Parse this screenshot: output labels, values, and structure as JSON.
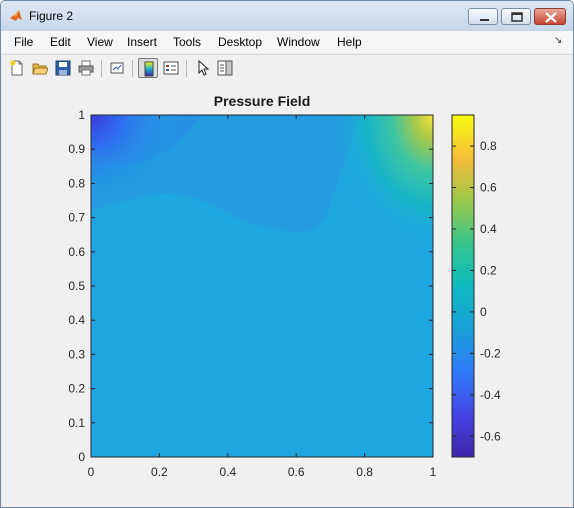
{
  "window": {
    "title": "Figure 2",
    "minimize_label": "minimize",
    "maximize_label": "maximize",
    "close_label": "close"
  },
  "menu": [
    "File",
    "Edit",
    "View",
    "Insert",
    "Tools",
    "Desktop",
    "Window",
    "Help"
  ],
  "toolbar": {
    "buttons": [
      "new-figure",
      "open-file",
      "save-figure",
      "print-figure",
      "link-plot",
      "insert-colorbar",
      "insert-legend",
      "edit-plot",
      "show-plot-tools"
    ],
    "pressed": "insert-colorbar"
  },
  "chart_data": {
    "type": "heatmap",
    "title": "Pressure Field",
    "xlabel": "",
    "ylabel": "",
    "xlim": [
      0,
      1
    ],
    "ylim": [
      0,
      1
    ],
    "xticks": [
      "0",
      "0.2",
      "0.4",
      "0.6",
      "0.8",
      "1"
    ],
    "yticks": [
      "0",
      "0.1",
      "0.2",
      "0.3",
      "0.4",
      "0.5",
      "0.6",
      "0.7",
      "0.8",
      "0.9",
      "1"
    ],
    "colorbar": {
      "range": [
        -0.7,
        0.95
      ],
      "ticks": [
        "0.8",
        "0.6",
        "0.4",
        "0.2",
        "0",
        "-0.2",
        "-0.4",
        "-0.6"
      ],
      "tick_values": [
        0.8,
        0.6,
        0.4,
        0.2,
        0,
        -0.2,
        -0.4,
        -0.6
      ],
      "colormap": "parula"
    },
    "field_notes": "mostly uniform near -0.1 with a low (-0.7) at top-left corner and a high (0.95) at top-right corner",
    "grid": false
  }
}
